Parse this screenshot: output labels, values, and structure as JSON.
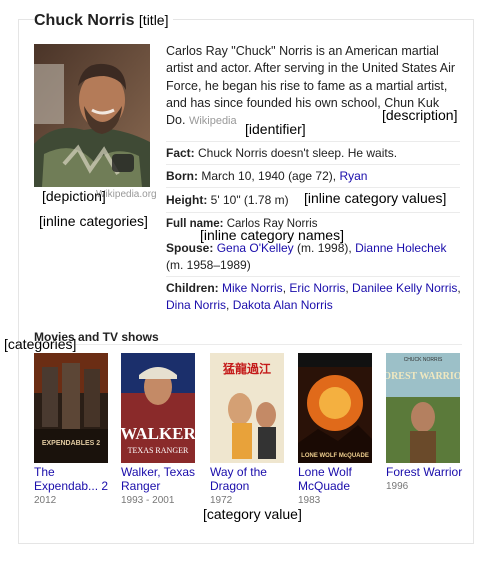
{
  "header": {
    "title": "Chuck Norris",
    "title_tag": "[title]"
  },
  "image": {
    "credit": "Wikipedia.org"
  },
  "description": {
    "text": "Carlos Ray \"Chuck\" Norris is an American martial artist and actor. After serving in the United States Air Force, he began his rise to fame as a martial artist, and has since founded his own school, Chun Kuk Do.",
    "source": "Wikipedia"
  },
  "facts": {
    "fact": {
      "label": "Fact:",
      "value": "Chuck Norris doesn't sleep. He waits."
    },
    "born": {
      "label": "Born:",
      "value": "March 10, 1940 (age 72),",
      "link": "Ryan"
    },
    "height": {
      "label": "Height:",
      "value": "5' 10\" (1.78 m)"
    },
    "full_name": {
      "label": "Full name:",
      "value": "Carlos Ray Norris"
    },
    "spouse": {
      "label": "Spouse:",
      "link1": "Gena O'Kelley",
      "after1": "(m. 1998),",
      "link2": "Dianne Holechek",
      "after2": "(m. 1958–1989)"
    },
    "children": {
      "label": "Children:",
      "names": [
        "Mike Norris",
        "Eric Norris",
        "Danilee Kelly Norris",
        "Dina Norris",
        "Dakota Alan Norris"
      ]
    }
  },
  "categories": {
    "title": "Movies and TV shows",
    "items": [
      {
        "name": "The Expendab... 2",
        "year": "2012"
      },
      {
        "name": "Walker, Texas Ranger",
        "year": "1993 - 2001"
      },
      {
        "name": "Way of the Dragon",
        "year": "1972"
      },
      {
        "name": "Lone Wolf McQuade",
        "year": "1983"
      },
      {
        "name": "Forest Warrior",
        "year": "1996"
      }
    ]
  },
  "poster_text": {
    "expendables": "EXPENDABLES 2",
    "walker": "WALKER",
    "walker_sub": "TEXAS RANGER",
    "dragon": "猛龍過江",
    "lonewolf": "LONE WOLF McQUADE",
    "forest": "FOREST WARRIOR",
    "forest_top": "CHUCK NORRIS"
  },
  "annotations": {
    "identifier": "[identifier]",
    "description": "[description]",
    "depiction": "[depiction]",
    "inline_category_values": "[inline category values]",
    "inline_categories": "[inline categories]",
    "inline_category_names": "[inline category names]",
    "categories": "[categories]",
    "category_value": "[category value]"
  }
}
